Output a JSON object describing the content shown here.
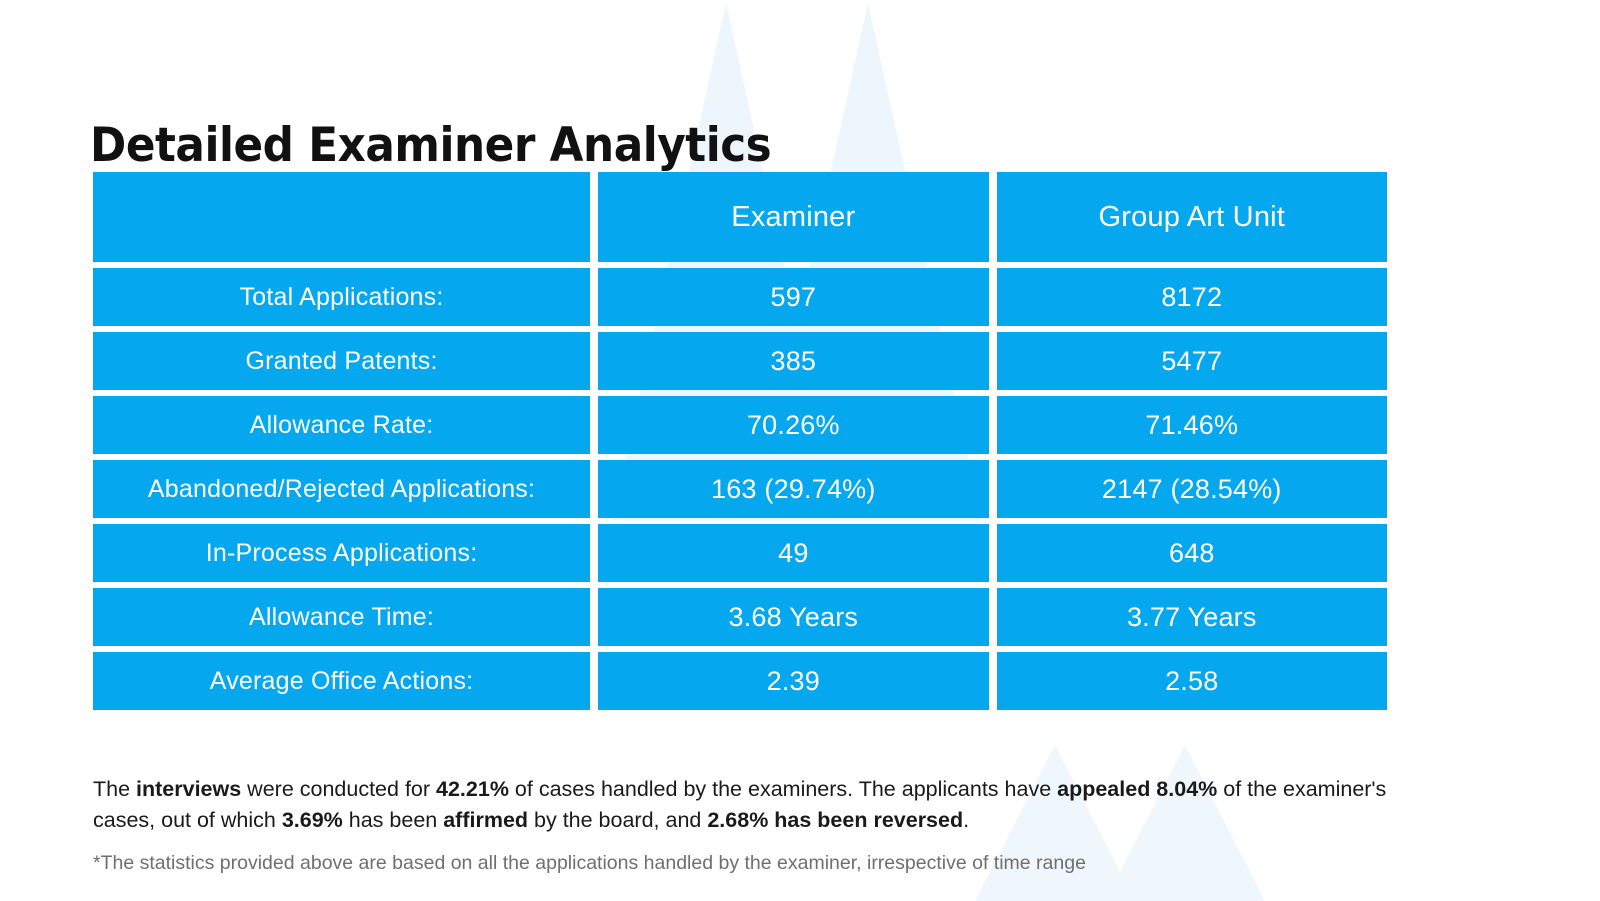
{
  "page": {
    "title": "Detailed Examiner Analytics",
    "background_color": "#FFFFFF",
    "accent_color": "#05A7EF",
    "watermark_color": "#EDF6FD",
    "title_color": "#111111",
    "note_color": "#1A1A1A",
    "disclaimer_color": "#6F6F6F"
  },
  "table": {
    "headers": {
      "metric": "",
      "examiner": "Examiner",
      "group_art_unit": "Group Art Unit"
    },
    "rows": [
      {
        "label": "Total Applications:",
        "examiner": "597",
        "group_art_unit": "8172"
      },
      {
        "label": "Granted Patents:",
        "examiner": "385",
        "group_art_unit": "5477"
      },
      {
        "label": "Allowance Rate:",
        "examiner": "70.26%",
        "group_art_unit": "71.46%"
      },
      {
        "label": "Abandoned/Rejected Applications:",
        "examiner": "163 (29.74%)",
        "group_art_unit": "2147 (28.54%)"
      },
      {
        "label": "In-Process Applications:",
        "examiner": "49",
        "group_art_unit": "648"
      },
      {
        "label": "Allowance Time:",
        "examiner": "3.68 Years",
        "group_art_unit": "3.77 Years"
      },
      {
        "label": "Average Office Actions:",
        "examiner": "2.39",
        "group_art_unit": "2.58"
      }
    ]
  },
  "summary_note": {
    "s1": "The ",
    "b1": "interviews",
    "s2": " were conducted for ",
    "b2": "42.21%",
    "s3": " of cases handled by the examiners. The applicants have ",
    "b3": "appealed 8.04%",
    "s4": " of the examiner's cases, out of which ",
    "b4": "3.69%",
    "s5": " has been ",
    "b5": "affirmed",
    "s6": " by the board, and ",
    "b6": "2.68% has been reversed",
    "s7": "."
  },
  "disclaimer": {
    "text": "*The statistics provided above are based on all the applications handled by the examiner, irrespective of time range"
  },
  "chart_data": {
    "type": "table",
    "title": "Detailed Examiner Analytics",
    "columns": [
      "",
      "Examiner",
      "Group Art Unit"
    ],
    "rows": [
      [
        "Total Applications:",
        "597",
        "8172"
      ],
      [
        "Granted Patents:",
        "385",
        "5477"
      ],
      [
        "Allowance Rate:",
        "70.26%",
        "71.46%"
      ],
      [
        "Abandoned/Rejected Applications:",
        "163 (29.74%)",
        "2147 (28.54%)"
      ],
      [
        "In-Process Applications:",
        "49",
        "648"
      ],
      [
        "Allowance Time:",
        "3.68 Years",
        "3.77 Years"
      ],
      [
        "Average Office Actions:",
        "2.39",
        "2.58"
      ]
    ],
    "metrics": {
      "total_applications": {
        "examiner": 597,
        "group_art_unit": 8172
      },
      "granted_patents": {
        "examiner": 385,
        "group_art_unit": 5477
      },
      "allowance_rate_pct": {
        "examiner": 70.26,
        "group_art_unit": 71.46
      },
      "abandoned_rejected": {
        "examiner": 163,
        "examiner_pct": 29.74,
        "group_art_unit": 2147,
        "group_art_unit_pct": 28.54
      },
      "in_process": {
        "examiner": 49,
        "group_art_unit": 648
      },
      "allowance_time_years": {
        "examiner": 3.68,
        "group_art_unit": 3.77
      },
      "average_office_actions": {
        "examiner": 2.39,
        "group_art_unit": 2.58
      },
      "interview_rate_pct": 42.21,
      "appeal_rate_pct": 8.04,
      "affirmed_pct": 3.69,
      "reversed_pct": 2.68
    }
  }
}
